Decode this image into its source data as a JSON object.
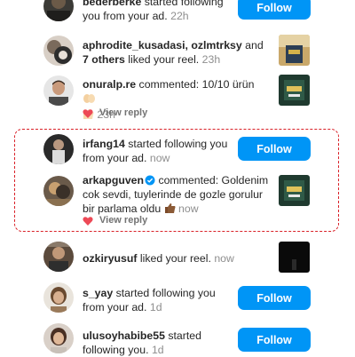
{
  "notifications": [
    {
      "user": "bederberke",
      "text": " started following you from your ad.",
      "time": "22h",
      "action": "Follow"
    },
    {
      "user": "aphrodite_kusadasi, ozlmtrksy",
      "connector": " and ",
      "others": "7 others",
      "text": " liked your reel.",
      "time": "23h"
    },
    {
      "user": "onuralp.re",
      "text": " commented: 10/10 ürün",
      "time": "23h",
      "view_reply": "View reply"
    },
    {
      "user": "irfang14",
      "text": " started following you from your ad.",
      "time": "now",
      "action": "Follow"
    },
    {
      "user": "arkapguven",
      "text": " commented: Goldenim cok sevdi, tuylerinde de gozle gorulur bir parlama oldu",
      "time": "now",
      "view_reply": "View reply"
    },
    {
      "user": "ozkiryusuf",
      "text": " liked your reel.",
      "time": "now"
    },
    {
      "user": "s_yay",
      "text": " started following you from your ad.",
      "time": "1d",
      "action": "Follow"
    },
    {
      "user": "ulusoyhabibe55",
      "text": " started following you.",
      "time": "1d",
      "action": "Follow"
    }
  ],
  "icons": {
    "heart": "heart-icon",
    "verified": "verified-badge-icon",
    "emoji_hands": "clapping-hands-emoji",
    "emoji_thumbs": "thumbs-up-emoji"
  },
  "colors": {
    "follow_button": "#0095f6",
    "highlight_border": "#d92027",
    "heart": "#ed4956",
    "verified": "#0095f6",
    "timestamp": "#8e8e8e"
  }
}
